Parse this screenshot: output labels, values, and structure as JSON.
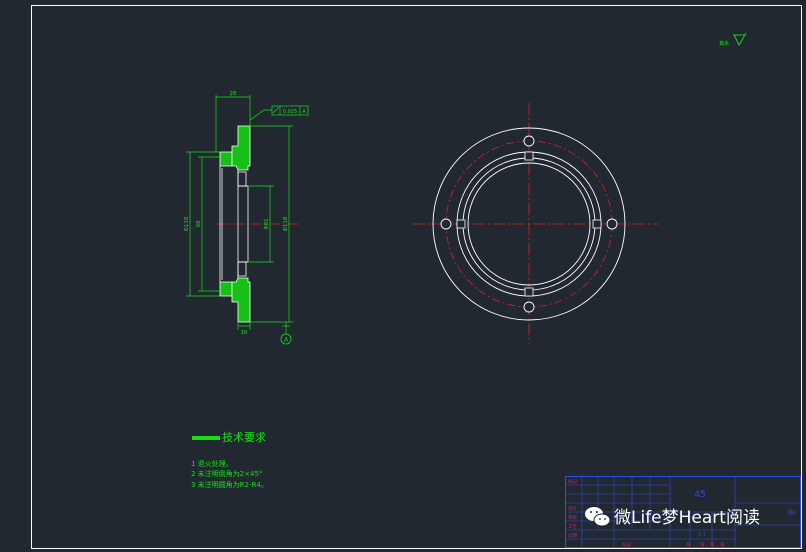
{
  "colors": {
    "background": "#212830",
    "border": "#ffffff",
    "part_outline": "#ffffff",
    "hatch": "#16c016",
    "dimension": "#16e016",
    "centerline": "#e02020",
    "text": "#20ff20",
    "title_block": "#2f4fe0",
    "watermark": "#ffffff"
  },
  "annotations": {
    "top_dim": "28",
    "tolerance_value": "0.025",
    "datum_ref": "A",
    "datum_label": "A",
    "dia_outer": "Φ118",
    "dia_mid": "98",
    "dia_bore": "Φ81",
    "dia_right": "Φ118",
    "bottom_dim": "10",
    "roughness_text": "其余"
  },
  "tech_requirements": {
    "title": "技术要求",
    "items": [
      "1 退火处理。",
      "2 未注明倒角为2×45°",
      "3 未注明圆角为R2-R4。"
    ]
  },
  "title_block": {
    "material": "45",
    "tag": "(图)",
    "scale": "1:1",
    "row_labels": [
      "标记",
      "设计",
      "审核",
      "工艺",
      "日期"
    ],
    "bottom_labels": [
      "共",
      "张",
      "第",
      "张"
    ]
  },
  "watermark": {
    "text": "微Life梦Heart阅读"
  }
}
